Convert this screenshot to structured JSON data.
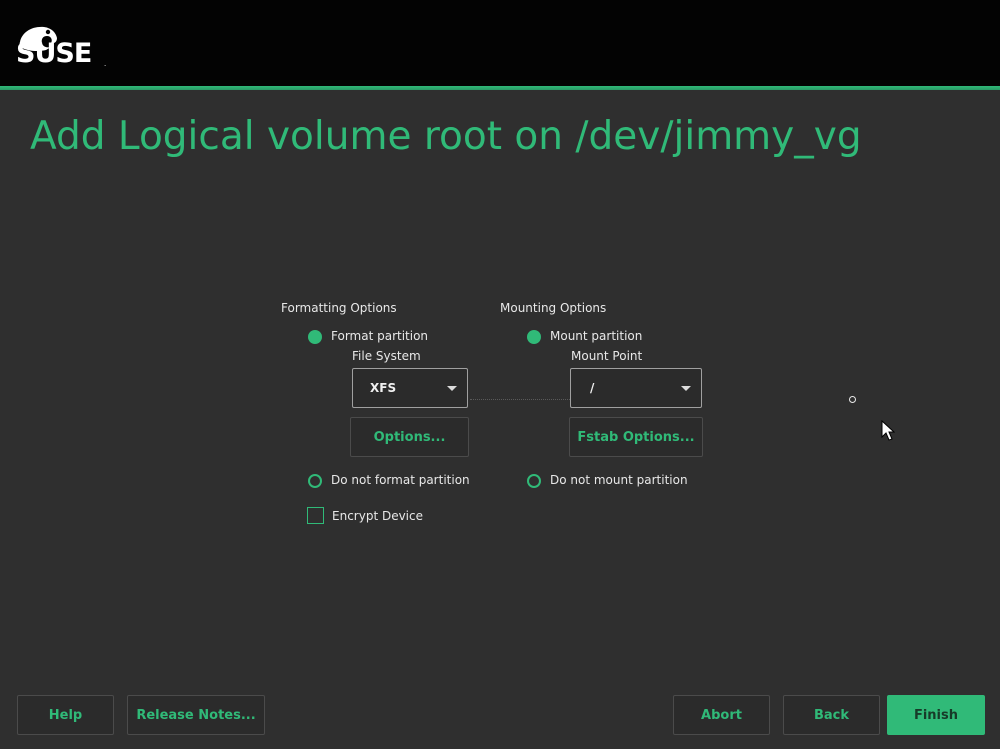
{
  "brand": {
    "name": "SUSE",
    "reg": "."
  },
  "page": {
    "title": "Add Logical volume root on /dev/jimmy_vg"
  },
  "formatting": {
    "header": "Formatting Options",
    "format_partition": "Format partition",
    "file_system_label": "File System",
    "file_system_value": "XFS",
    "options_button": "Options...",
    "do_not_format": "Do not format partition",
    "encrypt_device": "Encrypt Device"
  },
  "mounting": {
    "header": "Mounting Options",
    "mount_partition": "Mount partition",
    "mount_point_label": "Mount Point",
    "mount_point_value": "/",
    "fstab_button": "Fstab Options...",
    "do_not_mount": "Do not mount partition"
  },
  "footer": {
    "help": "Help",
    "release_notes": "Release Notes...",
    "abort": "Abort",
    "back": "Back",
    "finish": "Finish"
  },
  "colors": {
    "accent": "#30ba78",
    "background": "#2f2f2f",
    "topbar": "#030303"
  }
}
